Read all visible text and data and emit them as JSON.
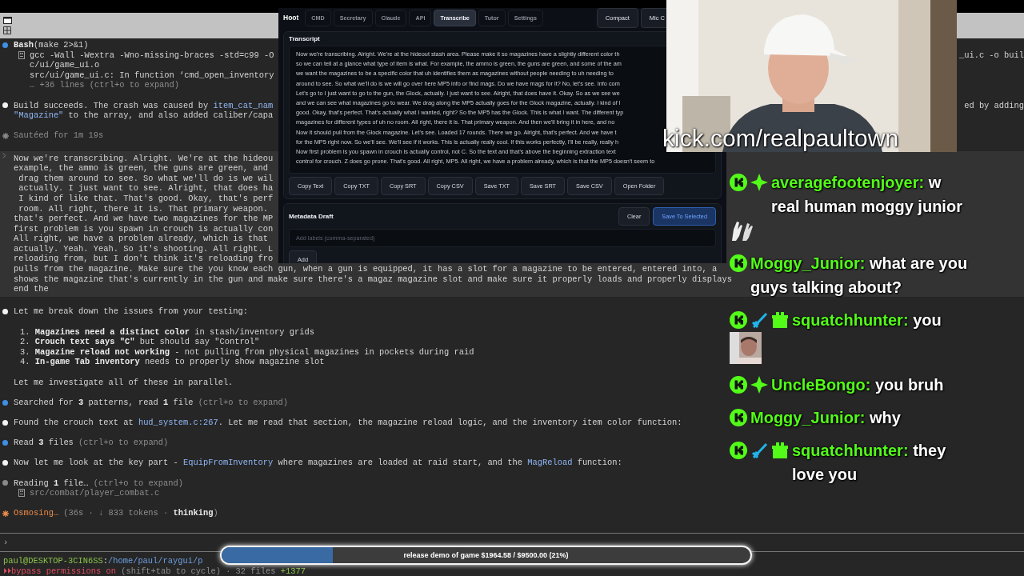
{
  "terminal": {
    "blocks": [
      {
        "kind": "blue-dot",
        "paragraphs": [
          [
            {
              "kind": "text",
              "segs": [
                {
                  "kind": "bold",
                  "text": "Bash"
                },
                {
                  "kind": "plain",
                  "text": "(make 2>&1)"
                }
              ]
            },
            {
              "kind": "output-icon",
              "segs": [
                {
                  "kind": "plain",
                  "text": "gcc -Wall -Wextra -Wno-missing-braces -std=c99 -O"
                }
              ],
              "tail": "_ui.c -o buil"
            },
            {
              "kind": "output",
              "segs": [
                {
                  "kind": "plain",
                  "text": "c/ui/game_ui.o"
                }
              ]
            },
            {
              "kind": "output",
              "segs": [
                {
                  "kind": "plain",
                  "text": "src/ui/game_ui.c: In function ‘cmd_open_inventory"
                }
              ]
            },
            {
              "kind": "output",
              "segs": [
                {
                  "kind": "dim",
                  "text": "… +36 lines (ctrl+o to expand)"
                }
              ]
            }
          ]
        ]
      },
      {
        "kind": "white-dot",
        "paragraphs": [
          [
            {
              "kind": "text",
              "segs": [
                {
                  "kind": "plain",
                  "text": "Build succeeds. The crash was caused by "
                },
                {
                  "kind": "code",
                  "text": "item_cat_nam"
                }
              ],
              "tail": "ed by adding"
            },
            {
              "kind": "text",
              "segs": [
                {
                  "kind": "code",
                  "text": "\"Magazine\""
                },
                {
                  "kind": "plain",
                  "text": " to the array, and also added caliber/capa"
                }
              ]
            }
          ]
        ]
      },
      {
        "kind": "grey-star",
        "paragraphs": [
          [
            {
              "kind": "text",
              "segs": [
                {
                  "kind": "dim",
                  "text": "Sautéed for 1m 19s"
                }
              ]
            }
          ]
        ]
      },
      {
        "kind": "input",
        "paragraphs": [
          [
            {
              "kind": "text",
              "segs": [
                {
                  "kind": "plain",
                  "text": "Now we're transcribing. Alright. We're at the hideou"
                }
              ]
            },
            {
              "kind": "text",
              "segs": [
                {
                  "kind": "plain",
                  "text": "example, the ammo is green, the guns are green, and"
                }
              ]
            },
            {
              "kind": "text",
              "segs": [
                {
                  "kind": "plain",
                  "text": " drag them around to see. So what we'll do is we wil"
                }
              ]
            },
            {
              "kind": "text",
              "segs": [
                {
                  "kind": "plain",
                  "text": " actually. I just want to see. Alright, that does ha"
                }
              ]
            },
            {
              "kind": "text",
              "segs": [
                {
                  "kind": "plain",
                  "text": " I kind of like that. That's good. Okay, that's perf"
                }
              ]
            },
            {
              "kind": "text",
              "segs": [
                {
                  "kind": "plain",
                  "text": " room. All right, there it is. That primary weapon."
                }
              ]
            },
            {
              "kind": "text",
              "segs": [
                {
                  "kind": "plain",
                  "text": "that's perfect. And we have two magazines for the MP"
                }
              ]
            },
            {
              "kind": "text",
              "segs": [
                {
                  "kind": "plain",
                  "text": "first problem is you spawn in crouch is actually con"
                }
              ]
            },
            {
              "kind": "text",
              "segs": [
                {
                  "kind": "plain",
                  "text": "All right, we have a problem already, which is that"
                }
              ]
            },
            {
              "kind": "text",
              "segs": [
                {
                  "kind": "plain",
                  "text": "actually. Yeah. Yeah. So it's shooting. All right. L"
                }
              ]
            },
            {
              "kind": "text",
              "segs": [
                {
                  "kind": "plain",
                  "text": "reloading from, but I don't think it's reloading fro"
                }
              ]
            },
            {
              "kind": "text",
              "segs": [
                {
                  "kind": "plain",
                  "text": "pulls from the magazine. Make sure the you know each gun, when a gun is equipped, it has a slot for a magazine to be entered, entered into, a"
                }
              ]
            },
            {
              "kind": "text",
              "segs": [
                {
                  "kind": "plain",
                  "text": "shows the magazine that's currently in the gun and make sure there's a magaz magazine slot and make sure it properly loads and properly displays"
                }
              ]
            },
            {
              "kind": "text",
              "segs": [
                {
                  "kind": "plain",
                  "text": "end the"
                }
              ]
            }
          ]
        ]
      },
      {
        "kind": "white-dot",
        "paragraphs": [
          [
            {
              "kind": "text",
              "segs": [
                {
                  "kind": "plain",
                  "text": "Let me break down the issues from your testing:"
                }
              ]
            }
          ],
          [
            {
              "kind": "item",
              "segs": [
                {
                  "kind": "plain",
                  "text": "1. "
                },
                {
                  "kind": "bold",
                  "text": "Magazines need a distinct color"
                },
                {
                  "kind": "plain",
                  "text": " in stash/inventory grids"
                }
              ]
            },
            {
              "kind": "item",
              "segs": [
                {
                  "kind": "plain",
                  "text": "2. "
                },
                {
                  "kind": "bold",
                  "text": "Crouch text says \"C\""
                },
                {
                  "kind": "plain",
                  "text": " but should say \"Control\""
                }
              ]
            },
            {
              "kind": "item",
              "segs": [
                {
                  "kind": "plain",
                  "text": "3. "
                },
                {
                  "kind": "bold",
                  "text": "Magazine reload not working"
                },
                {
                  "kind": "plain",
                  "text": " - not pulling from physical magazines in pockets during raid"
                }
              ]
            },
            {
              "kind": "item",
              "segs": [
                {
                  "kind": "plain",
                  "text": "4. "
                },
                {
                  "kind": "bold",
                  "text": "In-game Tab inventory"
                },
                {
                  "kind": "plain",
                  "text": " needs to properly show magazine slot"
                }
              ]
            }
          ],
          [
            {
              "kind": "text",
              "segs": [
                {
                  "kind": "plain",
                  "text": "Let me investigate all of these in parallel."
                }
              ]
            }
          ]
        ]
      },
      {
        "kind": "blue-dot",
        "paragraphs": [
          [
            {
              "kind": "text",
              "segs": [
                {
                  "kind": "plain",
                  "text": "Searched for "
                },
                {
                  "kind": "bold",
                  "text": "3"
                },
                {
                  "kind": "plain",
                  "text": " patterns, read "
                },
                {
                  "kind": "bold",
                  "text": "1"
                },
                {
                  "kind": "plain",
                  "text": " file "
                },
                {
                  "kind": "dim",
                  "text": "(ctrl+o to expand)"
                }
              ]
            }
          ]
        ]
      },
      {
        "kind": "white-dot",
        "paragraphs": [
          [
            {
              "kind": "text",
              "segs": [
                {
                  "kind": "plain",
                  "text": "Found the crouch text at "
                },
                {
                  "kind": "code",
                  "text": "hud_system.c:267"
                },
                {
                  "kind": "plain",
                  "text": ". Let me read that section, the magazine reload logic, and the inventory item color function:"
                }
              ]
            }
          ]
        ]
      },
      {
        "kind": "blue-dot",
        "paragraphs": [
          [
            {
              "kind": "text",
              "segs": [
                {
                  "kind": "plain",
                  "text": "Read "
                },
                {
                  "kind": "bold",
                  "text": "3"
                },
                {
                  "kind": "plain",
                  "text": " files "
                },
                {
                  "kind": "dim",
                  "text": "(ctrl+o to expand)"
                }
              ]
            }
          ]
        ]
      },
      {
        "kind": "white-dot",
        "paragraphs": [
          [
            {
              "kind": "text",
              "segs": [
                {
                  "kind": "plain",
                  "text": "Now let me look at the key part - "
                },
                {
                  "kind": "code",
                  "text": "EquipFromInventory"
                },
                {
                  "kind": "plain",
                  "text": " where magazines are loaded at raid start, and the "
                },
                {
                  "kind": "code",
                  "text": "MagReload"
                },
                {
                  "kind": "plain",
                  "text": " function:"
                }
              ]
            }
          ]
        ]
      },
      {
        "kind": "grey-dot",
        "paragraphs": [
          [
            {
              "kind": "text",
              "segs": [
                {
                  "kind": "plain",
                  "text": "Reading "
                },
                {
                  "kind": "bold",
                  "text": "1"
                },
                {
                  "kind": "plain",
                  "text": " file… "
                },
                {
                  "kind": "dim",
                  "text": "(ctrl+o to expand)"
                }
              ]
            },
            {
              "kind": "output-icon",
              "segs": [
                {
                  "kind": "dim",
                  "text": "src/combat/player_combat.c"
                }
              ]
            }
          ]
        ]
      },
      {
        "kind": "orange-star",
        "paragraphs": [
          [
            {
              "kind": "text",
              "segs": [
                {
                  "kind": "orange",
                  "text": "Osmosing…"
                },
                {
                  "kind": "dim",
                  "text": " (36s · ↓ 833 tokens · "
                },
                {
                  "kind": "bold",
                  "text": "thinking"
                },
                {
                  "kind": "dim",
                  "text": ")"
                }
              ]
            }
          ]
        ]
      }
    ],
    "prompt": "›",
    "footer": [
      {
        "segs": [
          {
            "kind": "green",
            "text": "paul@DESKTOP-3CIN6SS"
          },
          {
            "kind": "plain",
            "text": ":"
          },
          {
            "kind": "path",
            "text": "/home/paul/raygui/p"
          }
        ]
      },
      {
        "segs": [
          {
            "kind": "red",
            "text": "⏵⏵bypass permissions on"
          },
          {
            "kind": "dim",
            "text": " (shift+tab to cycle) · 32 files "
          },
          {
            "kind": "green",
            "text": "+1377"
          }
        ]
      }
    ]
  },
  "app": {
    "brand": "Hoot",
    "tabs": [
      {
        "label": "CMD",
        "selected": false
      },
      {
        "label": "Secretary",
        "selected": false
      },
      {
        "label": "Claude",
        "selected": false
      },
      {
        "label": "API",
        "selected": false
      },
      {
        "label": "Transcribe",
        "selected": true
      },
      {
        "label": "Tutor",
        "selected": false
      },
      {
        "label": "Settings",
        "selected": false
      }
    ],
    "header_buttons": [
      "Compact",
      "Mic C"
    ],
    "transcript": {
      "title": "Transcript",
      "lines": [
        "Now we're transcribing. Alright. We're at the hideout stash area. Please make it so magazines have a slightly different color th",
        "so we can tell at a glance what type of item is what. For example, the ammo is green, the guns are green, and some of the am",
        "we want the magazines to be a specific color that uh identifies them as magazines without people needing to uh needing to",
        "around to see. So what we'll do is we will go over here MP5 info or find mags. Do we have mags for it? No, let's see. Info com",
        "Let's go to I just want to go to the gun, the Glock, actually. I just want to see. Alright, that does have it. Okay. So as we see we",
        "and we can see what magazines go to wear. We drag along the MP5 actually goes for the Glock magazine, actually. I kind of l",
        "good. Okay, that's perfect. That's actually what I wanted, right? So the MP5 has the Glock. This is what I want. The different typ",
        "magazines for different types of uh no room. All right, there it is. That primary weapon. And then we'll bring it in here, and no",
        "Now it should pull from the Glock magazine. Let's see. Loaded 17 rounds. There we go. Alright, that's perfect. And we have t",
        "for the MP5 right now. So we'll see. We'll see if it works. This is actually really cool. If this works perfectly, I'll be really, really h",
        "Now first problem is you spawn in crouch is actually control, not C. So the text and that's above the beginning extraction text",
        "control for crouch. Z does go prone. That's good. All right, MP5. All right, we have a problem already, which is that the MP5 doesn't seem to"
      ]
    },
    "transcript_buttons": [
      "Copy Text",
      "Copy TXT",
      "Copy SRT",
      "Copy CSV",
      "Save TXT",
      "Save SRT",
      "Save CSV",
      "Open Folder"
    ],
    "metadata": {
      "title": "Metadata Draft",
      "buttons": [
        {
          "label": "Clear",
          "kind": "plain"
        },
        {
          "label": "Save To Selected",
          "kind": "primary"
        }
      ],
      "field": {
        "placeholder": "Add labels (comma-separated)"
      },
      "add_button": "Add"
    }
  },
  "stream_url": "kick.com/realpaultown",
  "chat": [
    {
      "badges": [
        {
          "kind": "kick"
        },
        {
          "kind": "sparkle"
        }
      ],
      "user": "averagefootenjoyer:",
      "text": "w real human moggy junior",
      "emote": {
        "kind": "hands"
      }
    },
    {
      "badges": [
        {
          "kind": "kick"
        }
      ],
      "user": "Moggy_Junior:",
      "text": "what are you guys talking about?"
    },
    {
      "badges": [
        {
          "kind": "kick"
        },
        {
          "kind": "sword"
        },
        {
          "kind": "gift"
        }
      ],
      "user": "squatchhunter:",
      "text": "you",
      "emote": {
        "kind": "picture"
      }
    },
    {
      "badges": [
        {
          "kind": "kick"
        },
        {
          "kind": "sparkle"
        }
      ],
      "user": "UncleBongo:",
      "text": "you bruh"
    },
    {
      "badges": [
        {
          "kind": "kick"
        }
      ],
      "user": "Moggy_Junior:",
      "text": "why"
    },
    {
      "badges": [
        {
          "kind": "kick"
        },
        {
          "kind": "sword"
        },
        {
          "kind": "gift"
        }
      ],
      "user": "squatchhunter:",
      "text": "they love you"
    }
  ],
  "goal": {
    "label": "release demo of game $1964.58 / $9500.00 (21%)",
    "level": 0.21
  }
}
